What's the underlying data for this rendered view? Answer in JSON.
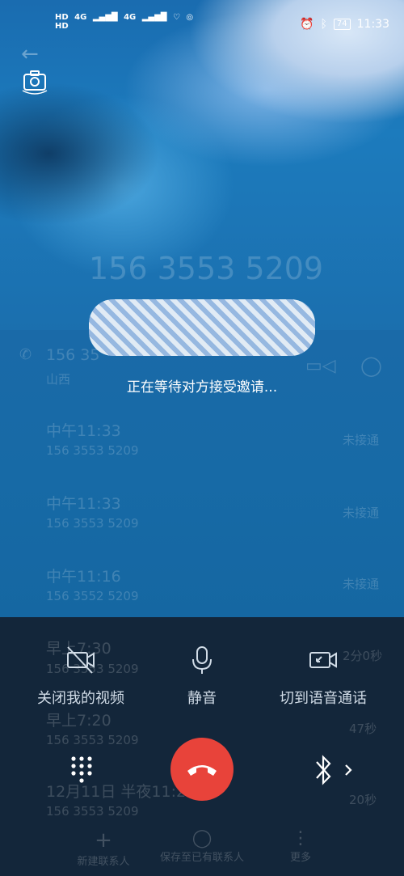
{
  "status_bar": {
    "left_indicators": [
      "HD",
      "HD",
      "4G",
      "4G"
    ],
    "battery": "74",
    "time": "11:33"
  },
  "call": {
    "background_number": "156 3553 5209",
    "waiting_text": "正在等待对方接受邀请...",
    "caller_line_partial": "156 35",
    "caller_location_partial": "山西"
  },
  "call_log": [
    {
      "time": "中午11:33",
      "number": "156 3553 5209",
      "status": "未接通"
    },
    {
      "time": "中午11:33",
      "number": "156 3553 5209",
      "status": "未接通"
    },
    {
      "time": "中午11:16",
      "number": "156 3552 5209",
      "status": "未接通"
    },
    {
      "time": "早上7:30",
      "number": "156 3553 5209",
      "status": "2分0秒"
    },
    {
      "time": "早上7:20",
      "number": "156 3553 5209",
      "status": "47秒"
    },
    {
      "time": "12月11日 半夜11:28",
      "number": "156 3553 5209",
      "status": "20秒"
    }
  ],
  "actions": {
    "video_off": "关闭我的视频",
    "mute": "静音",
    "switch_voice": "切到语音通话"
  },
  "bottom_nav": {
    "new_contact": "新建联系人",
    "save_existing": "保存至已有联系人",
    "more": "更多"
  },
  "icons": {
    "back": "arrow-left-icon",
    "camera_switch": "camera-switch-icon",
    "hangup": "phone-hangup-icon",
    "bluetooth": "bluetooth-icon",
    "dialpad": "dialpad-icon"
  },
  "colors": {
    "hangup": "#e8433a",
    "controls_bg": "#13263a"
  }
}
